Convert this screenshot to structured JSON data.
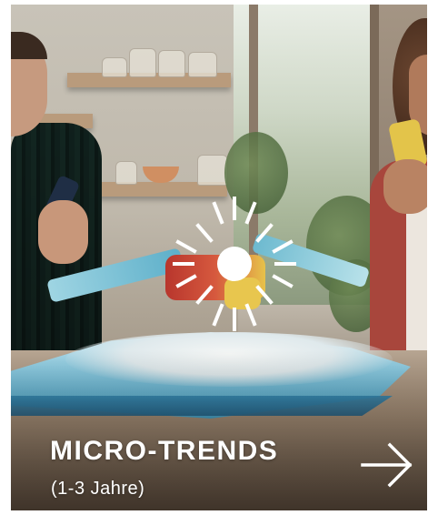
{
  "card": {
    "title": "MICRO-TRENDS",
    "subtitle": "(1-3 Jahre)",
    "arrow_icon": "arrow-right-icon",
    "overlay_icon": "sun-icon",
    "text_color": "#ffffff"
  }
}
